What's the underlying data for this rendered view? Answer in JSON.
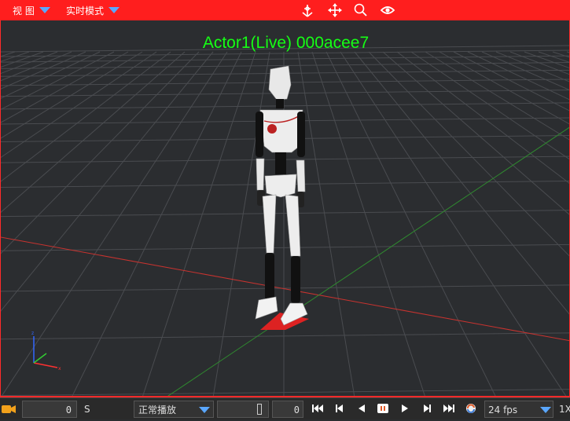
{
  "toolbar": {
    "view_menu": "视 图",
    "mode_menu": "实时模式",
    "tools": [
      "joint-icon",
      "move-icon",
      "zoom-icon",
      "eye-icon"
    ]
  },
  "viewport": {
    "actor_label": "Actor1(Live) 000acee7",
    "label_color": "#15ff15",
    "border_color": "#ff2a2a",
    "axis_colors": {
      "x": "#ff3030",
      "y": "#33cc33",
      "z": "#3366ff"
    }
  },
  "bottombar": {
    "frame_unit": "S",
    "frame_value": "0",
    "end_value": "0",
    "play_mode": "正常播放",
    "fps": "24 fps",
    "speed": "1X"
  }
}
